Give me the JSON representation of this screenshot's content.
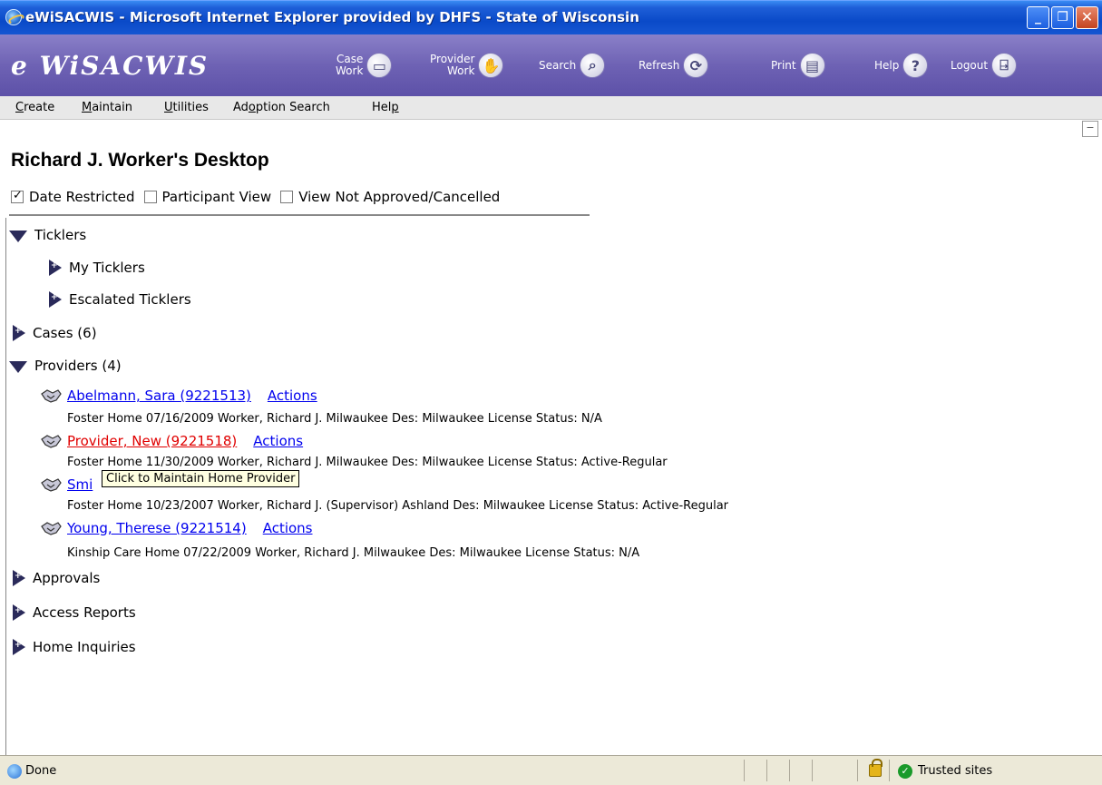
{
  "window": {
    "title": "eWiSACWIS - Microsoft Internet Explorer provided by DHFS - State of Wisconsin",
    "minimize": "_",
    "maximize": "❐",
    "close": "✕"
  },
  "app": {
    "logo": "e WiSACWIS",
    "toolbar": [
      {
        "label_line1": "Case",
        "label_line2": "Work",
        "icon": "folder-icon",
        "glyph": "▭"
      },
      {
        "label_line1": "Provider",
        "label_line2": "Work",
        "icon": "handshake-icon",
        "glyph": "✋"
      },
      {
        "label_line1": "Search",
        "label_line2": "",
        "icon": "magnifier-icon",
        "glyph": "⌕"
      },
      {
        "label_line1": "Refresh",
        "label_line2": "",
        "icon": "refresh-icon",
        "glyph": "⟳"
      },
      {
        "label_line1": "Print",
        "label_line2": "",
        "icon": "printer-icon",
        "glyph": "▤"
      },
      {
        "label_line1": "Help",
        "label_line2": "",
        "icon": "help-icon",
        "glyph": "?"
      },
      {
        "label_line1": "Logout",
        "label_line2": "",
        "icon": "door-icon",
        "glyph": "⍈"
      }
    ]
  },
  "menu": [
    {
      "accel": "C",
      "rest": "reate"
    },
    {
      "accel": "M",
      "rest": "aintain"
    },
    {
      "accel": "U",
      "rest": "tilities"
    },
    {
      "pre": "Ad",
      "accel": "o",
      "rest": "ption Search"
    },
    {
      "pre": "Hel",
      "accel": "p",
      "rest": ""
    }
  ],
  "collapse": "−",
  "page_title": "Richard J. Worker's Desktop",
  "filters": [
    {
      "label": "Date Restricted",
      "checked": true
    },
    {
      "label": "Participant View",
      "checked": false
    },
    {
      "label": "View Not Approved/Cancelled",
      "checked": false
    }
  ],
  "tree": {
    "ticklers": "Ticklers",
    "my_ticklers": "My Ticklers",
    "escalated_ticklers": "Escalated Ticklers",
    "cases": "Cases (6)",
    "providers": "Providers (4)",
    "approvals": "Approvals",
    "access_reports": "Access Reports",
    "home_inquiries": "Home Inquiries"
  },
  "providers": [
    {
      "name": "Abelmann, Sara (9221513)",
      "actions": "Actions",
      "detail": "Foster Home  07/16/2009  Worker, Richard J.   Milwaukee   Des: Milwaukee   License Status: N/A"
    },
    {
      "name": "Provider, New (9221518)",
      "actions": "Actions",
      "detail": "Foster Home  11/30/2009  Worker, Richard J.   Milwaukee   Des: Milwaukee   License Status: Active-Regular"
    },
    {
      "name": "Smi",
      "actions": "",
      "detail": "Foster Home  10/23/2007  Worker, Richard J. (Supervisor)    Ashland   Des: Milwaukee   License Status: Active-Regular"
    },
    {
      "name": "Young, Therese (9221514)",
      "actions": "Actions",
      "detail": "Kinship Care Home  07/22/2009  Worker, Richard J.   Milwaukee   Des: Milwaukee   License Status: N/A"
    }
  ],
  "tooltip": "Click to Maintain Home Provider",
  "status": {
    "text": "Done",
    "zone": "Trusted sites"
  }
}
